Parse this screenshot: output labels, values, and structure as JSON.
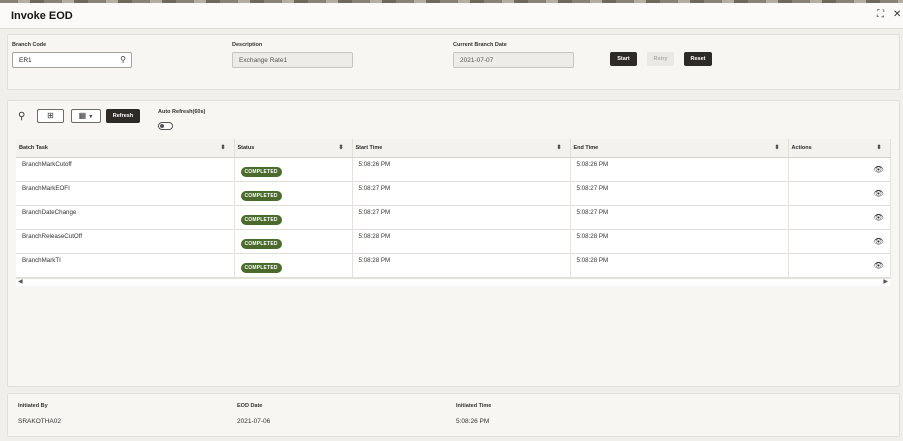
{
  "window": {
    "title": "Invoke EOD"
  },
  "form": {
    "branch_code": {
      "label": "Branch Code",
      "value": "ER1"
    },
    "description": {
      "label": "Description",
      "value": "Exchange Rate1"
    },
    "current_branch_date": {
      "label": "Current Branch Date",
      "value": "2021-07-07"
    },
    "buttons": {
      "start": "Start",
      "retry": "Retry",
      "reset": "Reset"
    }
  },
  "toolbar": {
    "refresh": "Refresh",
    "auto_refresh": "Auto Refresh(60s)"
  },
  "table": {
    "columns": [
      "Batch Task",
      "Status",
      "Start Time",
      "End Time",
      "Actions"
    ],
    "rows": [
      {
        "task": "BranchMarkCutoff",
        "status": "COMPLETED",
        "start": "5:08:26 PM",
        "end": "5:08:26 PM"
      },
      {
        "task": "BranchMarkEOFI",
        "status": "COMPLETED",
        "start": "5:08:27 PM",
        "end": "5:08:27 PM"
      },
      {
        "task": "BranchDateChange",
        "status": "COMPLETED",
        "start": "5:08:27 PM",
        "end": "5:08:27 PM"
      },
      {
        "task": "BranchReleaseCutOff",
        "status": "COMPLETED",
        "start": "5:08:28 PM",
        "end": "5:08:28 PM"
      },
      {
        "task": "BranchMarkTI",
        "status": "COMPLETED",
        "start": "5:08:28 PM",
        "end": "5:08:28 PM"
      }
    ]
  },
  "footer": {
    "initiated_by": {
      "label": "Initiated By",
      "value": "SRAKOTHA02"
    },
    "eod_date": {
      "label": "EOD Date",
      "value": "2021-07-06"
    },
    "initiated_time": {
      "label": "Initiated Time",
      "value": "5:08:26 PM"
    }
  },
  "colors": {
    "badge": "#4a6b2c",
    "dark_button": "#2e2b27"
  },
  "icons": [
    "search-icon",
    "tree-view-icon",
    "grid-columns-icon",
    "eye-icon",
    "sort-icon",
    "maximize-icon",
    "close-icon"
  ]
}
